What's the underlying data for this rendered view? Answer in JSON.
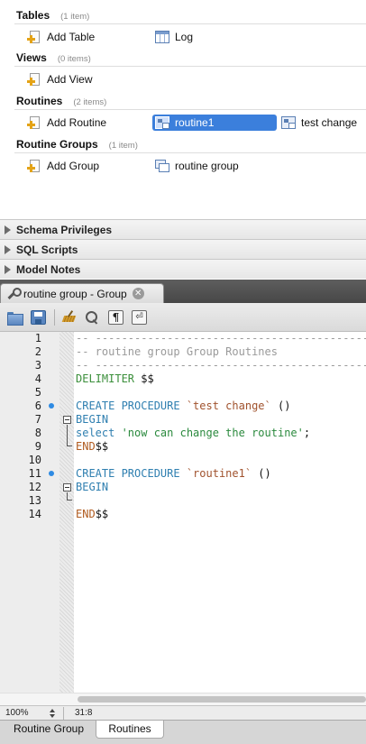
{
  "sections": {
    "tables": {
      "title": "Tables",
      "count": "(1 item)",
      "add_label": "Add Table",
      "items": [
        {
          "label": "Log"
        }
      ]
    },
    "views": {
      "title": "Views",
      "count": "(0 items)",
      "add_label": "Add View",
      "items": []
    },
    "routines": {
      "title": "Routines",
      "count": "(2 items)",
      "add_label": "Add Routine",
      "items": [
        {
          "label": "routine1",
          "selected": true
        },
        {
          "label": "test change"
        }
      ]
    },
    "routine_groups": {
      "title": "Routine Groups",
      "count": "(1 item)",
      "add_label": "Add Group",
      "items": [
        {
          "label": "routine group"
        }
      ]
    }
  },
  "panels": [
    "Schema Privileges",
    "SQL Scripts",
    "Model Notes"
  ],
  "editor_tab": {
    "label": "routine group - Group",
    "close_glyph": "✕"
  },
  "toolbar": {
    "icons": [
      "open-folder-icon",
      "save-icon",
      "beautify-broom-icon",
      "find-icon",
      "pilcrow-icon",
      "word-wrap-icon"
    ],
    "pilcrow": "¶",
    "wrap_glyph": "⏎"
  },
  "code": {
    "lines": [
      {
        "num": "1",
        "text": "-- ------------------------------------------------------------------",
        "cls": "t-comment"
      },
      {
        "num": "2",
        "text": "-- routine group Group Routines",
        "cls": "t-comment"
      },
      {
        "num": "3",
        "text": "-- ------------------------------------------------------------------",
        "cls": "t-comment"
      },
      {
        "num": "4",
        "parts": [
          {
            "t": "DELIMITER ",
            "c": "t-kw2"
          },
          {
            "t": "$$",
            "c": "t-plain"
          }
        ]
      },
      {
        "num": "5",
        "text": ""
      },
      {
        "num": "6",
        "marker": true,
        "parts": [
          {
            "t": "CREATE PROCEDURE ",
            "c": "t-kw"
          },
          {
            "t": "`test change`",
            "c": "t-id"
          },
          {
            "t": " ()",
            "c": "t-plain"
          }
        ]
      },
      {
        "num": "7",
        "parts": [
          {
            "t": "BEGIN",
            "c": "t-kw"
          }
        ]
      },
      {
        "num": "8",
        "parts": [
          {
            "t": "select ",
            "c": "t-kw"
          },
          {
            "t": "'now can change the routine'",
            "c": "t-str"
          },
          {
            "t": ";",
            "c": "t-plain"
          }
        ]
      },
      {
        "num": "9",
        "parts": [
          {
            "t": "END",
            "c": "t-end"
          },
          {
            "t": "$$",
            "c": "t-plain"
          }
        ]
      },
      {
        "num": "10",
        "text": ""
      },
      {
        "num": "11",
        "marker": true,
        "parts": [
          {
            "t": "CREATE PROCEDURE ",
            "c": "t-kw"
          },
          {
            "t": "`routine1`",
            "c": "t-id"
          },
          {
            "t": " ()",
            "c": "t-plain"
          }
        ]
      },
      {
        "num": "12",
        "parts": [
          {
            "t": "BEGIN",
            "c": "t-kw"
          }
        ]
      },
      {
        "num": "13",
        "text": ""
      },
      {
        "num": "14",
        "parts": [
          {
            "t": "END",
            "c": "t-end"
          },
          {
            "t": "$$",
            "c": "t-plain"
          }
        ]
      }
    ]
  },
  "status": {
    "zoom": "100%",
    "cursor": "31:8"
  },
  "bottom_tabs": [
    {
      "label": "Routine Group",
      "active": false
    },
    {
      "label": "Routines",
      "active": true
    }
  ],
  "colors": {
    "selection": "#3b7fdc",
    "keyword": "#2f7fb0",
    "string": "#2b8a3e",
    "comment": "#9a9a9a",
    "marker": "#2f8be3"
  }
}
